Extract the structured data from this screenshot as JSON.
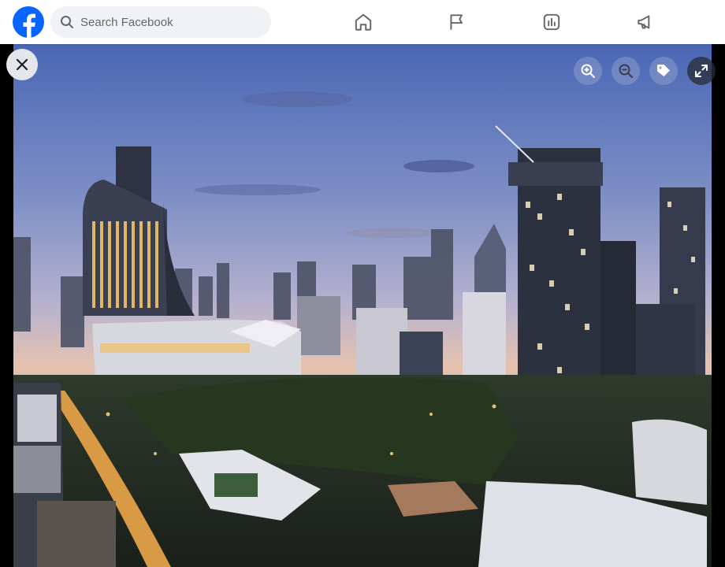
{
  "topbar": {
    "logo_icon": "facebook-logo-icon",
    "brand_color": "#0866ff",
    "search": {
      "placeholder": "Search Facebook",
      "value": ""
    },
    "nav_icons": [
      "home-icon",
      "pages-flag-icon",
      "ads-manager-icon",
      "megaphone-icon"
    ]
  },
  "viewer": {
    "close_icon": "close-icon",
    "controls": [
      "zoom-in-icon",
      "zoom-out-icon",
      "tag-icon",
      "fullscreen-icon"
    ]
  }
}
